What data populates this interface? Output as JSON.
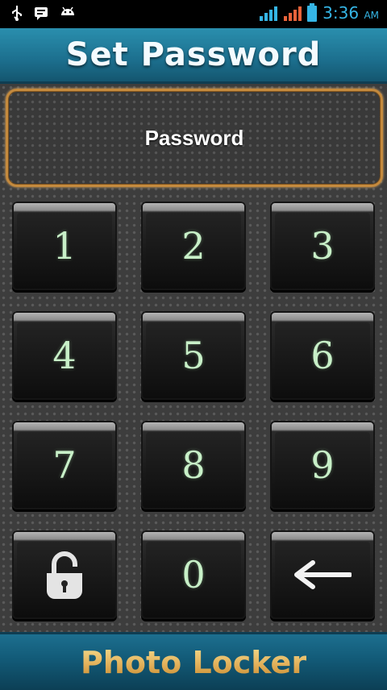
{
  "status_bar": {
    "icons_left": [
      "usb-icon",
      "message-icon",
      "android-icon"
    ],
    "icons_right": [
      "signal-icon",
      "signal-icon",
      "battery-icon"
    ],
    "time": "3:36",
    "ampm": "AM"
  },
  "header": {
    "title": "Set Password"
  },
  "password": {
    "placeholder": "Password"
  },
  "keypad": {
    "k1": "1",
    "k2": "2",
    "k3": "3",
    "k4": "4",
    "k5": "5",
    "k6": "6",
    "k7": "7",
    "k8": "8",
    "k9": "9",
    "k0": "0",
    "unlock_icon": "unlock-icon",
    "backspace_icon": "left-arrow-icon"
  },
  "footer": {
    "title": "Photo Locker"
  },
  "colors": {
    "title_bar": "#1c6f8e",
    "key_text": "#c8f0c8",
    "password_border": "#c48a3e",
    "footer_text": "#e2b15b"
  }
}
